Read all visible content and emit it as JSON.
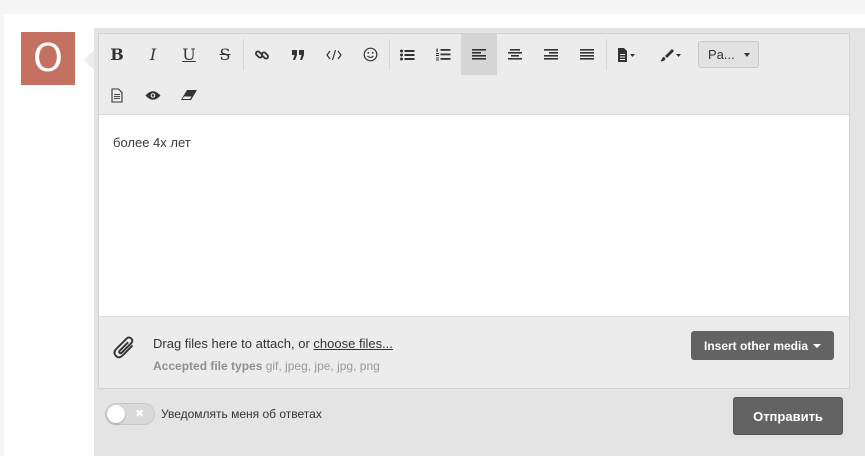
{
  "avatar": {
    "letter": "O",
    "color": "#c57162"
  },
  "toolbar": {
    "bold": "B",
    "italic": "I",
    "underline": "U",
    "strike": "S",
    "paragraph_select": "Pa..."
  },
  "editor": {
    "content": "более 4х лет"
  },
  "attach": {
    "drag_text": "Drag files here to attach, or ",
    "choose_link": "choose files...",
    "accepted_label": "Accepted file types",
    "accepted_types": " gif, jpeg, jpe, jpg, png",
    "insert_media": "Insert other media"
  },
  "footer": {
    "toggle_off_mark": "✖",
    "notify_label": "Уведомлять меня об ответах",
    "submit": "Отправить"
  }
}
